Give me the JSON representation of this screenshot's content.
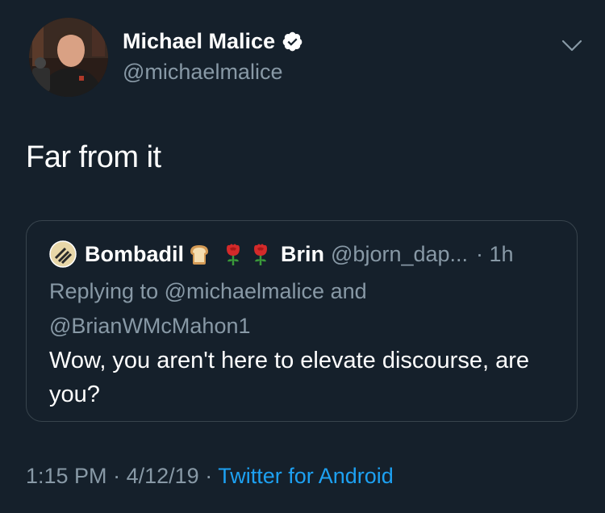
{
  "author": {
    "display_name": "Michael Malice",
    "handle": "@michaelmalice",
    "verified": true
  },
  "tweet": {
    "text": "Far from it"
  },
  "quoted_tweet": {
    "name_first": "Bombadil",
    "name_emojis": [
      "bread-emoji",
      "rose-emoji",
      "rose-emoji"
    ],
    "name_second": "Brin",
    "handle": "@bjorn_dap...",
    "time": "· 1h",
    "replying_prefix": "Replying to",
    "reply_to_1": "@michaelmalice",
    "reply_joiner": "and",
    "reply_to_2": "@BrianWMcMahon1",
    "text": "Wow, you aren't here to elevate discourse, are you?"
  },
  "meta": {
    "time": "1:15 PM",
    "sep1": "·",
    "date": "4/12/19",
    "sep2": "·",
    "source": "Twitter for Android"
  },
  "colors": {
    "background": "#15202b",
    "secondary_text": "#8899a6",
    "accent": "#1da1f2",
    "border": "#38444d"
  }
}
